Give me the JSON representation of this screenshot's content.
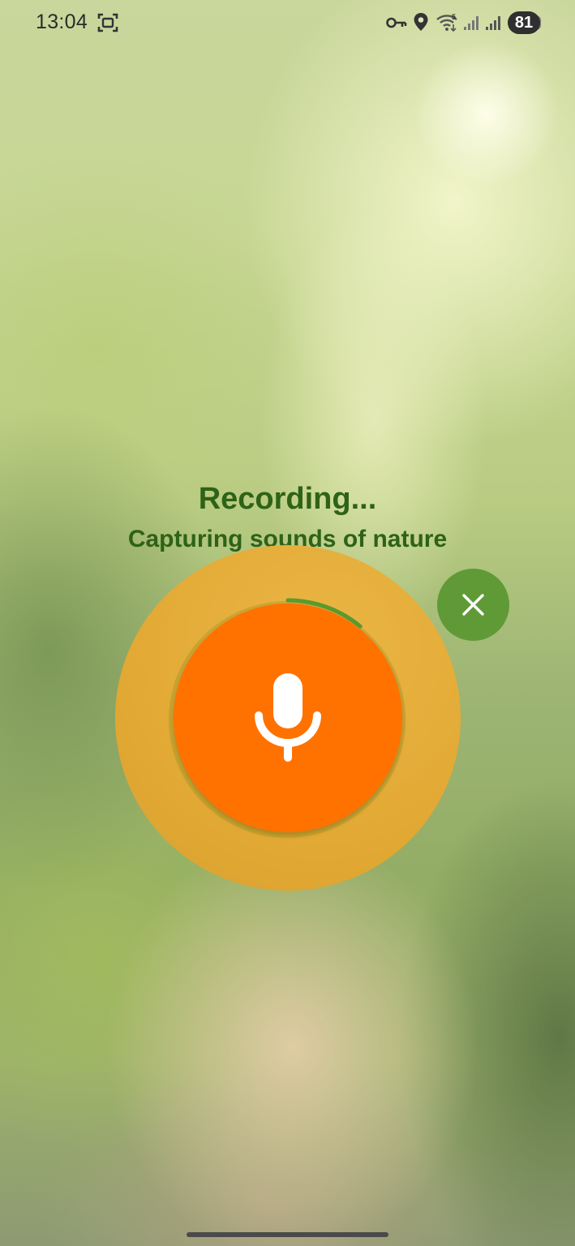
{
  "status_bar": {
    "time": "13:04",
    "battery_level": "81",
    "icons": [
      "screenshot-icon",
      "vpn-key-icon",
      "location-icon",
      "wifi-icon",
      "signal-icon",
      "signal-icon"
    ],
    "wifi_label": "5"
  },
  "recording": {
    "title": "Recording...",
    "subtitle": "Capturing sounds of nature",
    "progress_fraction": 0.11,
    "mic_icon": "microphone-icon",
    "close_icon": "close-icon"
  },
  "colors": {
    "title_green": "#2e6217",
    "outer_ring": "#e2a934",
    "mic_button": "#ff7200",
    "progress_arc": "#5a9a2e",
    "close_button": "#5f9a36"
  }
}
